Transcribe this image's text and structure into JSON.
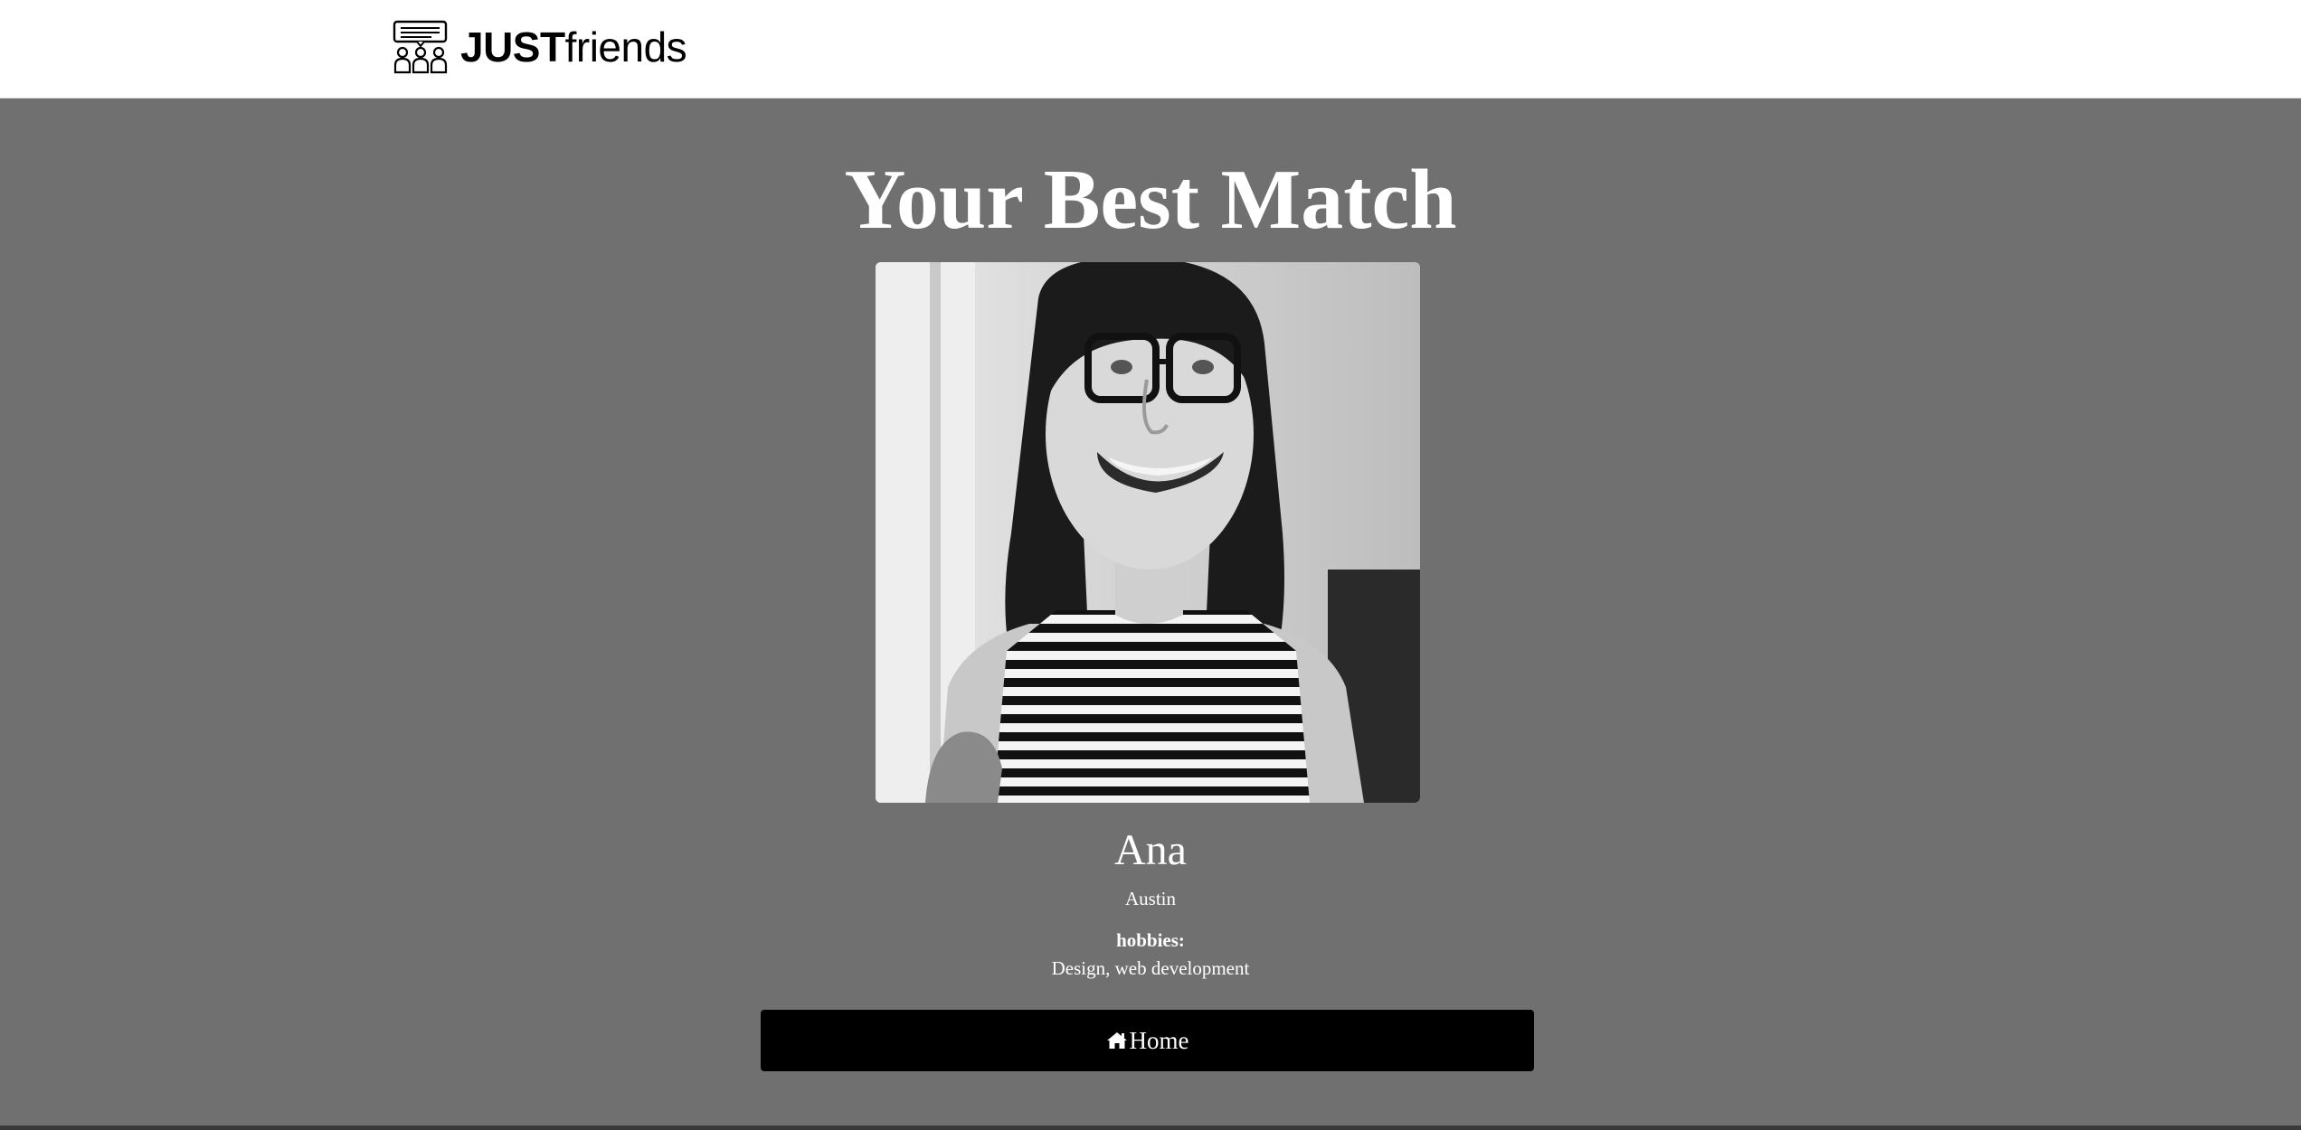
{
  "brand": {
    "name_bold": "JUST",
    "name_light": "friends",
    "logo_icon": "group-chat-icon"
  },
  "match": {
    "title": "Your Best Match",
    "photo_alt": "Ana",
    "name": "Ana",
    "city": "Austin",
    "hobbies_label": "hobbies:",
    "hobbies_value": "Design, web development"
  },
  "actions": {
    "home_label": "Home",
    "home_icon": "home-icon"
  },
  "colors": {
    "navbar_bg": "#ffffff",
    "page_bg": "#707070",
    "text": "#ffffff",
    "button_bg": "#000000",
    "button_text": "#ffffff"
  }
}
